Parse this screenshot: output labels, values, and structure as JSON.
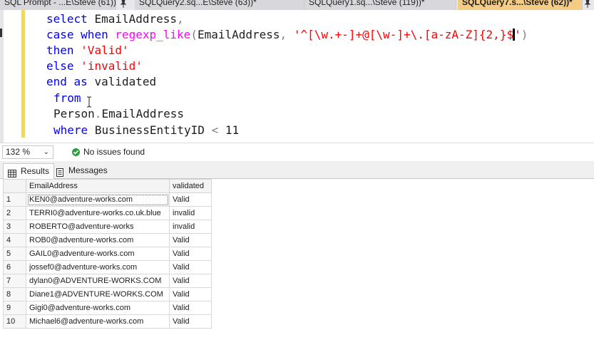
{
  "tabs": [
    {
      "label": "SQL Prompt - ...E\\Steve (61))",
      "active": false
    },
    {
      "label": "SQLQuery2.sq...E\\Steve (63))*",
      "active": false
    },
    {
      "label": "SQLQuery1.sq...\\Steve (119))*",
      "active": false
    },
    {
      "label": "SQLQuery7.s...\\Steve (62))*",
      "active": true
    }
  ],
  "editor": {
    "lines": [
      [
        "select",
        "EmailAddress",
        ","
      ],
      [
        "case",
        "when",
        "regexp_like",
        "(",
        "EmailAddress",
        ",",
        "'^[\\w.+-]+@[\\w-]+\\.[a-zA-Z]{2,}$",
        "'",
        ")"
      ],
      [
        "then",
        "'Valid'"
      ],
      [
        "else",
        "'invalid'"
      ],
      [
        "end",
        "as",
        "validated"
      ],
      [
        "from"
      ],
      [
        "Person",
        ".",
        "EmailAddress"
      ],
      [
        "where",
        "BusinessEntityID",
        "<",
        "11"
      ]
    ]
  },
  "status": {
    "zoom": "132 %",
    "issues": "No issues found"
  },
  "results": {
    "tabs": [
      {
        "label": "Results",
        "active": true
      },
      {
        "label": "Messages",
        "active": false
      }
    ],
    "columns": [
      "EmailAddress",
      "validated"
    ],
    "rows": [
      [
        "1",
        "KEN0@adventure-works.com",
        "Valid"
      ],
      [
        "2",
        "TERRI0@adventure-works.co.uk.blue",
        "invalid"
      ],
      [
        "3",
        "ROBERTO@adventure-works",
        "invalid"
      ],
      [
        "4",
        "ROB0@adventure-works.com",
        "Valid"
      ],
      [
        "5",
        "GAIL0@adventure-works.com",
        "Valid"
      ],
      [
        "6",
        "jossef0@adventure-works.com",
        "Valid"
      ],
      [
        "7",
        "dylan0@ADVENTURE-WORKS.COM",
        "Valid"
      ],
      [
        "8",
        "Diane1@ADVENTURE-WORKS.COM",
        "Valid"
      ],
      [
        "9",
        "Gigi0@adventure-works.com",
        "Valid"
      ],
      [
        "10",
        "Michael6@adventure-works.com",
        "Valid"
      ]
    ]
  },
  "colors": {
    "keyword": "#0000ff",
    "function": "#ff00ff",
    "string": "#ff0000",
    "active_tab": "#f5cc84",
    "success": "#2e9e44"
  },
  "icons": [
    "pin-icon",
    "check-circle-icon",
    "grid-icon",
    "messages-icon",
    "chevron-down-icon"
  ]
}
